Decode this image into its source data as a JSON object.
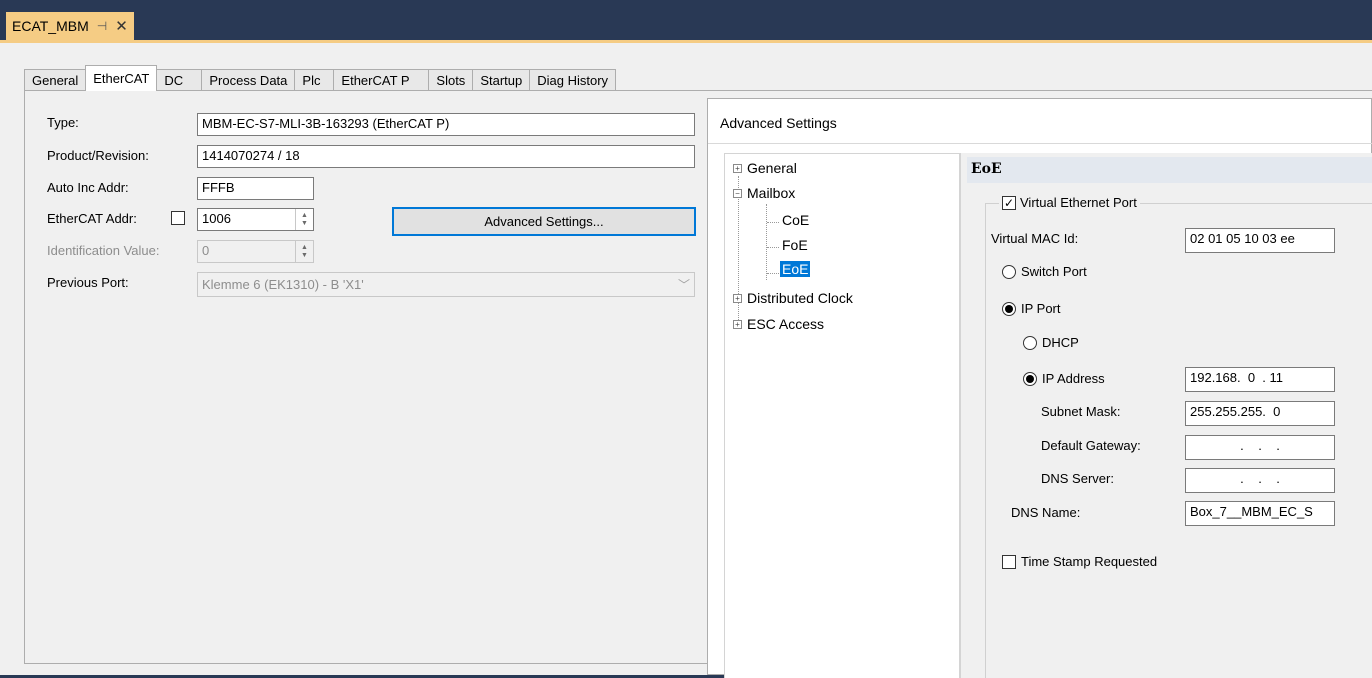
{
  "document_tab": {
    "title": "ECAT_MBM",
    "pin": "⊣",
    "close": "✕"
  },
  "tabs": [
    "General",
    "EtherCAT",
    "DC",
    "Process Data",
    "Plc",
    "EtherCAT P",
    "Slots",
    "Startup",
    "Diag History"
  ],
  "active_tab": "EtherCAT",
  "ethercat": {
    "type_label": "Type:",
    "type_value": "MBM-EC-S7-MLI-3B-163293 (EtherCAT P)",
    "product_label": "Product/Revision:",
    "product_value": "1414070274 / 18",
    "autoinc_label": "Auto Inc Addr:",
    "autoinc_value": "FFFB",
    "ecaddr_label": "EtherCAT Addr:",
    "ecaddr_value": "1006",
    "ident_label": "Identification Value:",
    "ident_value": "0",
    "prevport_label": "Previous Port:",
    "prevport_value": "Klemme 6 (EK1310) - B 'X1'",
    "advanced_button": "Advanced Settings..."
  },
  "advanced": {
    "title": "Advanced Settings",
    "tree": {
      "general": "General",
      "mailbox": "Mailbox",
      "coe": "CoE",
      "foe": "FoE",
      "eoe": "EoE",
      "dc": "Distributed Clock",
      "esc": "ESC Access"
    },
    "eoe": {
      "header": "EoE",
      "virtual_eth": "Virtual Ethernet Port",
      "virtual_eth_checked": true,
      "mac_label": "Virtual MAC Id:",
      "mac_value": "02 01 05 10 03 ee",
      "switch_port": "Switch Port",
      "ip_port": "IP Port",
      "dhcp": "DHCP",
      "ip_address_label": "IP Address",
      "ip_address_value": "192.168.  0  . 11",
      "subnet_label": "Subnet Mask:",
      "subnet_value": "255.255.255.  0",
      "gateway_label": "Default Gateway:",
      "gateway_value": "  .    .    .  ",
      "dns_server_label": "DNS Server:",
      "dns_server_value": "  .    .    .  ",
      "dns_name_label": "DNS Name:",
      "dns_name_value": "Box_7__MBM_EC_S",
      "timestamp": "Time Stamp Requested"
    }
  }
}
